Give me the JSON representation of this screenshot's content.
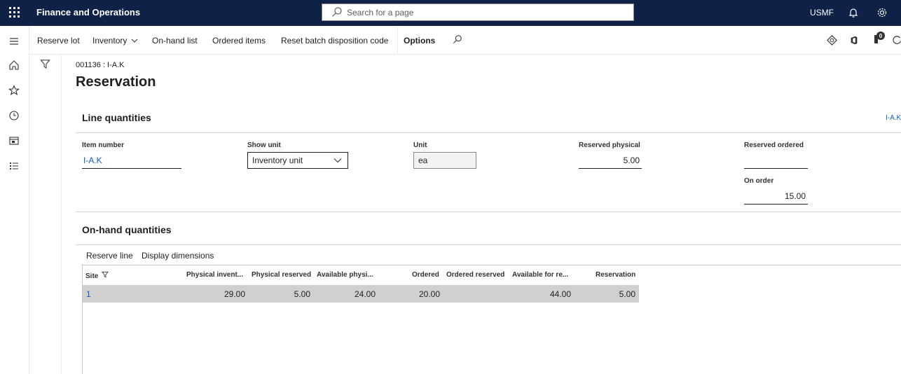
{
  "app": {
    "title": "Finance and Operations",
    "company": "USMF"
  },
  "search": {
    "placeholder": "Search for a page"
  },
  "toolbar": {
    "items": [
      "Reserve lot",
      "Inventory",
      "On-hand list",
      "Ordered items",
      "Reset batch disposition code",
      "Options"
    ],
    "badge_count": "0"
  },
  "breadcrumb": "001136 : I-A.K",
  "page_title": "Reservation",
  "line_quantities": {
    "title": "Line quantities",
    "right_link": "I-A.K",
    "item_number": {
      "label": "Item number",
      "value": "I-A.K"
    },
    "show_unit": {
      "label": "Show unit",
      "value": "Inventory unit"
    },
    "unit": {
      "label": "Unit",
      "value": "ea"
    },
    "reserved_physical": {
      "label": "Reserved physical",
      "value": "5.00"
    },
    "reserved_ordered": {
      "label": "Reserved ordered",
      "value": ""
    },
    "on_order": {
      "label": "On order",
      "value": "15.00"
    }
  },
  "on_hand": {
    "title": "On-hand quantities",
    "actions": [
      "Reserve line",
      "Display dimensions"
    ],
    "columns": [
      "Site",
      "Physical invent...",
      "Physical reserved",
      "Available physi...",
      "Ordered",
      "Ordered reserved",
      "Available for re...",
      "Reservation"
    ],
    "rows": [
      {
        "site": "1",
        "physical_inventory": "29.00",
        "physical_reserved": "5.00",
        "available_physical": "24.00",
        "ordered": "20.00",
        "ordered_reserved": "",
        "available_for_reservation": "44.00",
        "reservation": "5.00"
      }
    ]
  }
}
